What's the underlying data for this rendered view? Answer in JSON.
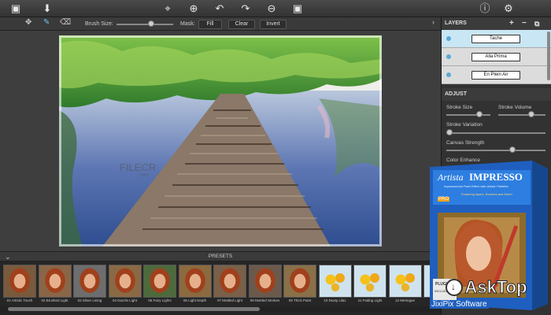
{
  "toolbar2": {
    "brush_size_label": "Brush Size:",
    "mask_label": "Mask:",
    "fill_label": "Fill",
    "clear_label": "Clear",
    "invert_label": "Invert"
  },
  "layers": {
    "title": "LAYERS",
    "items": [
      {
        "label": "Tache",
        "selected": true
      },
      {
        "label": "Alla Prima",
        "selected": false
      },
      {
        "label": "En Plein Air",
        "selected": false
      }
    ]
  },
  "adjust": {
    "title": "ADJUST",
    "stroke_size": "Stroke Size",
    "stroke_volume": "Stroke Volume",
    "stroke_variation": "Stroke Variation",
    "canvas_strength": "Canvas Strength",
    "color_enhance": "Color Enhance"
  },
  "presets": {
    "title": "PRESETS",
    "items": [
      {
        "label": "01 Artistic Touch",
        "style": "portrait"
      },
      {
        "label": "02 Brushed Light",
        "style": "portrait"
      },
      {
        "label": "03 Silver Lining",
        "style": "portrait"
      },
      {
        "label": "04 Dazzle Light",
        "style": "portrait"
      },
      {
        "label": "05 Fairy Lights",
        "style": "portrait"
      },
      {
        "label": "06 Light Depth",
        "style": "portrait"
      },
      {
        "label": "07 Mottled Light",
        "style": "portrait"
      },
      {
        "label": "08 Mottled Strokes",
        "style": "portrait"
      },
      {
        "label": "09 Thick Paint",
        "style": "portrait"
      },
      {
        "label": "10 Dusty Lilac",
        "style": "flowers"
      },
      {
        "label": "11 Fading Light",
        "style": "flowers"
      },
      {
        "label": "12 Meringue",
        "style": "flowers"
      },
      {
        "label": "13 …",
        "style": "flowers"
      }
    ]
  },
  "watermarks": {
    "filecr": "FILECR",
    "filecr_sub": ".com",
    "asktop": "AskTop"
  },
  "boxart": {
    "brand": "Artista",
    "product": "IMPRESSO",
    "tagline": "Impressionist Paint Effect with Artists' Palettes",
    "banner": "Featuring layers, Brushes and More!",
    "badge": "PRO",
    "plugin": "PLUGIN",
    "included": "INCLUDED",
    "publisher": "JixiPix Software"
  },
  "colors": {
    "accent": "#5aa9d6",
    "panel": "#323232",
    "selected_layer": "#c9e6f5"
  }
}
